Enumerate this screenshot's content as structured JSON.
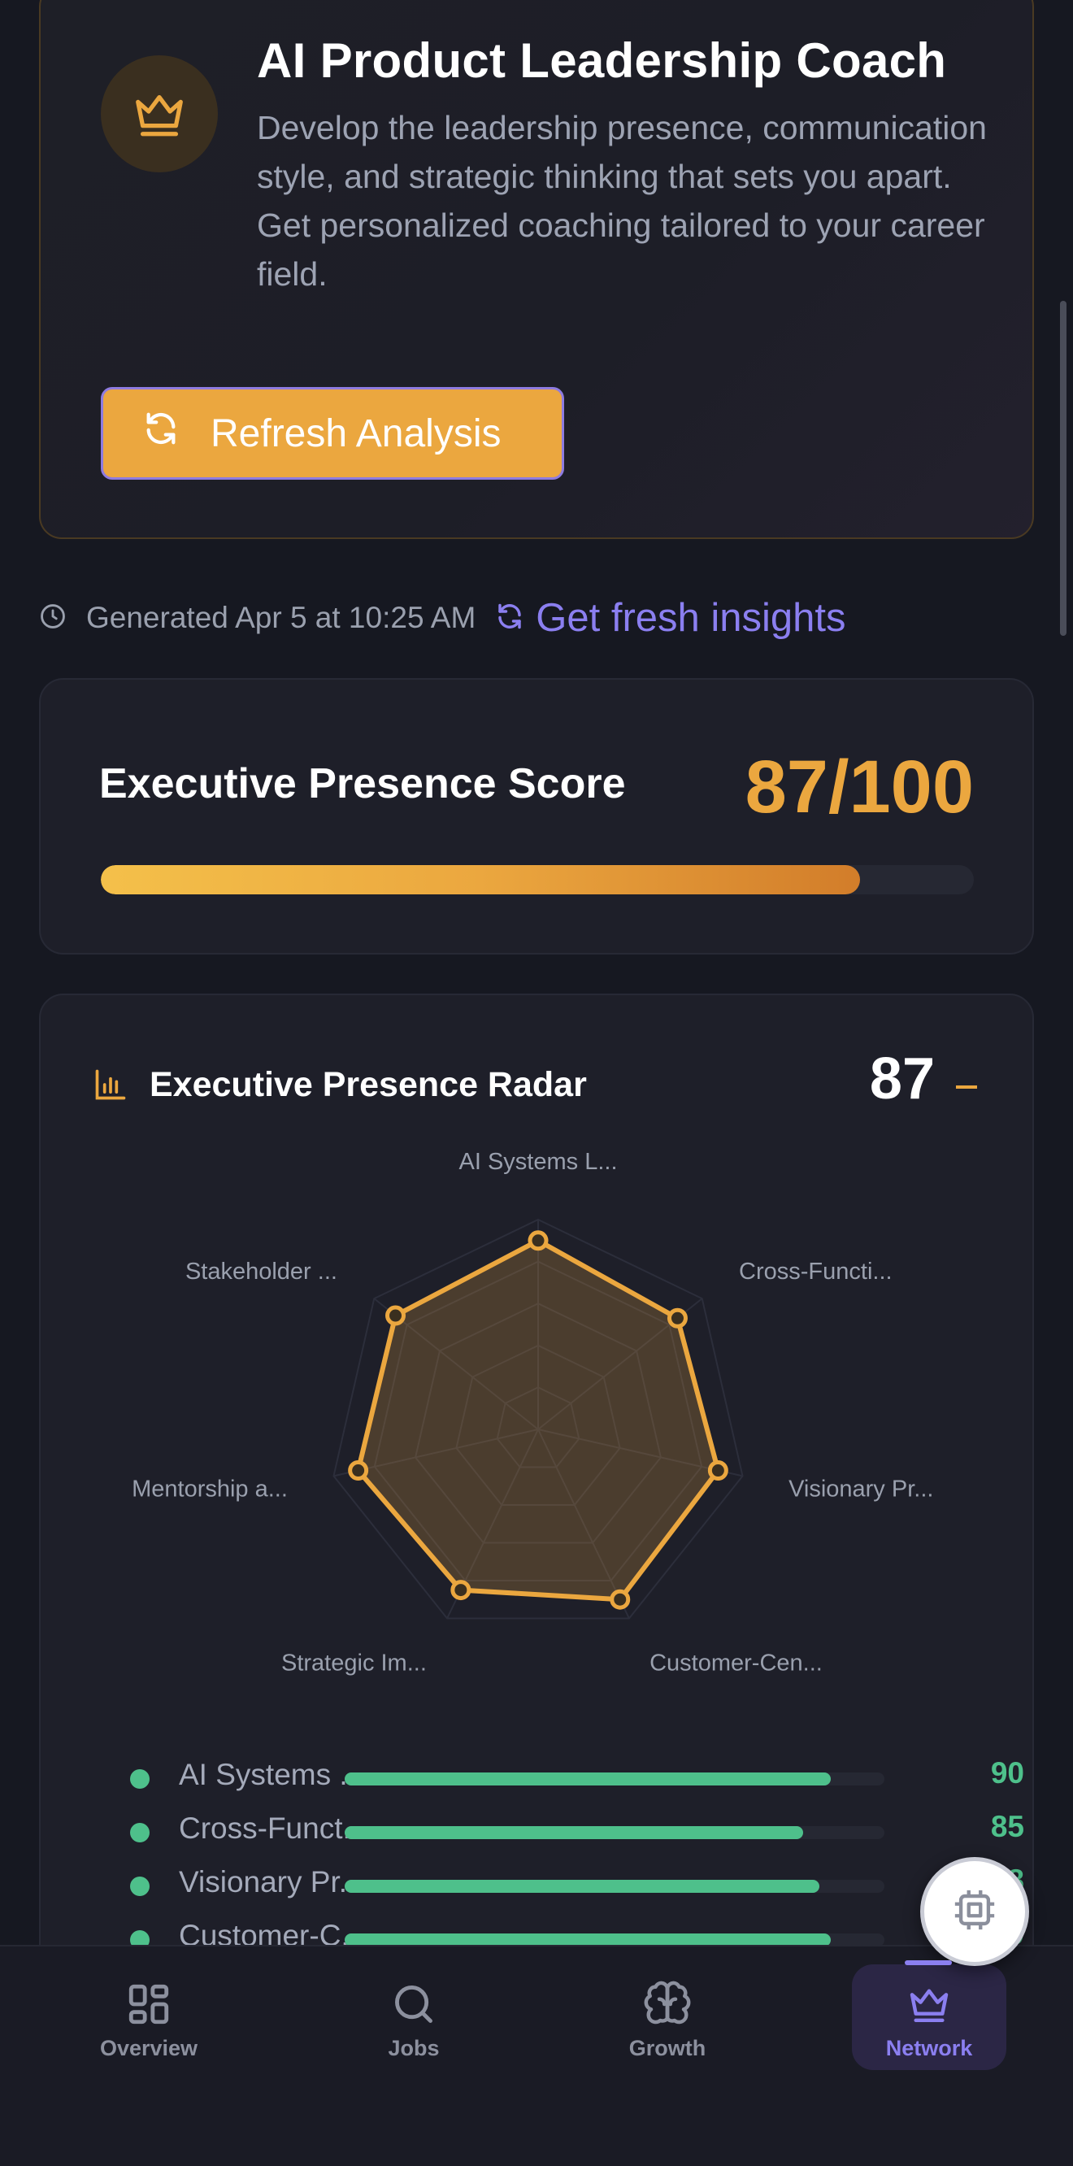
{
  "hero": {
    "title": "AI Product Leadership Coach",
    "description": "Develop the leadership presence, communication style, and strategic thinking that sets you apart. Get personalized coaching tailored to your career field.",
    "icon": "crown-icon",
    "refresh_label": "Refresh Analysis"
  },
  "meta": {
    "generated": "Generated Apr 5 at 10:25 AM",
    "fresh_link": "Get fresh insights"
  },
  "score": {
    "label": "Executive Presence Score",
    "value_text": "87/100",
    "value": 87,
    "max": 100
  },
  "radar": {
    "title": "Executive Presence Radar",
    "score": "87",
    "chart_data": {
      "type": "radar",
      "axes": [
        "AI Systems L...",
        "Cross-Functi...",
        "Visionary Pr...",
        "Customer-Cen...",
        "Strategic Im...",
        "Mentorship a...",
        "Stakeholder ..."
      ],
      "values": [
        90,
        85,
        88,
        90,
        85,
        88,
        87
      ],
      "range": [
        0,
        100
      ],
      "color": "#eba73f"
    },
    "legend": [
      {
        "label": "AI Systems ...",
        "value": "90",
        "fraction": 0.9
      },
      {
        "label": "Cross-Funct...",
        "value": "85",
        "fraction": 0.85
      },
      {
        "label": "Visionary Pr...",
        "value": "88",
        "fraction": 0.88
      },
      {
        "label": "Customer-C...",
        "value": "90",
        "fraction": 0.9
      }
    ]
  },
  "nav": {
    "items": [
      {
        "label": "Overview",
        "icon": "grid-icon"
      },
      {
        "label": "Jobs",
        "icon": "search-icon"
      },
      {
        "label": "Growth",
        "icon": "brain-icon"
      },
      {
        "label": "Network",
        "icon": "crown-icon",
        "active": true
      }
    ]
  },
  "fab": {
    "icon": "chip-icon"
  },
  "colors": {
    "accent": "#eba73f",
    "link": "#8b7ff0",
    "success": "#4ec08b",
    "background": "#161821"
  }
}
